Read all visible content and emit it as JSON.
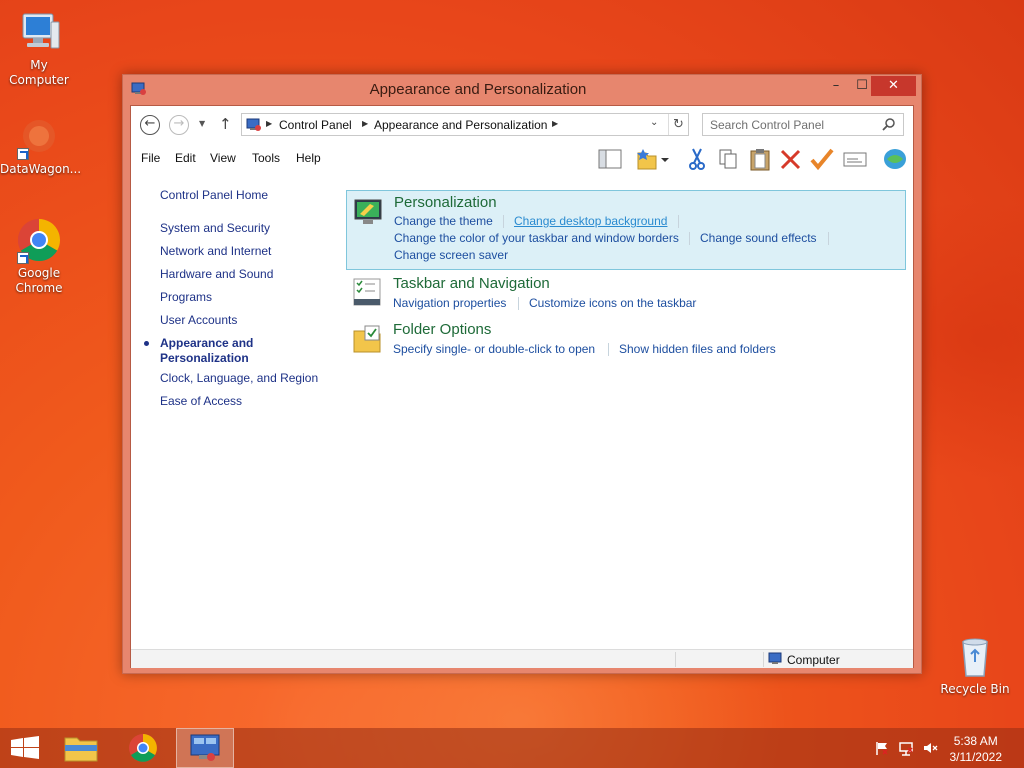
{
  "desktop": {
    "icons": [
      {
        "label": "My Computer"
      },
      {
        "label": "DataWagon..."
      },
      {
        "label": "Google Chrome"
      },
      {
        "label": "Recycle Bin"
      }
    ]
  },
  "window": {
    "title": "Appearance and Personalization",
    "controls": {
      "minimize": "–",
      "maximize": "☐",
      "close": "✕"
    }
  },
  "address": {
    "crumbs": [
      "Control Panel",
      "Appearance and Personalization"
    ],
    "search_placeholder": "Search Control Panel"
  },
  "menu": [
    "File",
    "Edit",
    "View",
    "Tools",
    "Help"
  ],
  "toolbar": [
    "layout-icon",
    "favorites-folder-icon",
    "cut-icon",
    "copy-icon",
    "paste-icon",
    "delete-icon",
    "apply-icon",
    "properties-icon",
    "world-icon"
  ],
  "leftnav": {
    "home": "Control Panel Home",
    "items": [
      "System and Security",
      "Network and Internet",
      "Hardware and Sound",
      "Programs",
      "User Accounts",
      "Appearance and Personalization",
      "Clock, Language, and Region",
      "Ease of Access"
    ],
    "active_line1": "Appearance and",
    "active_line2": "Personalization"
  },
  "sections": [
    {
      "title": "Personalization",
      "links": [
        "Change the theme",
        "Change desktop background",
        "Change the color of your taskbar and window borders",
        "Change sound effects",
        "Change screen saver"
      ]
    },
    {
      "title": "Taskbar and Navigation",
      "links": [
        "Navigation properties",
        "Customize icons on the taskbar"
      ]
    },
    {
      "title": "Folder Options",
      "links": [
        "Specify single- or double-click to open",
        "Show hidden files and folders"
      ]
    }
  ],
  "statusbar": {
    "text": "Computer"
  },
  "taskbar": {
    "time": "5:38 AM",
    "date": "3/11/2022"
  },
  "colors": {
    "desktop": "#e8461a",
    "window_frame": "#e7866e",
    "link": "#1e4fa0",
    "section_title": "#1e6a38",
    "highlight": "#dcf0f7"
  }
}
